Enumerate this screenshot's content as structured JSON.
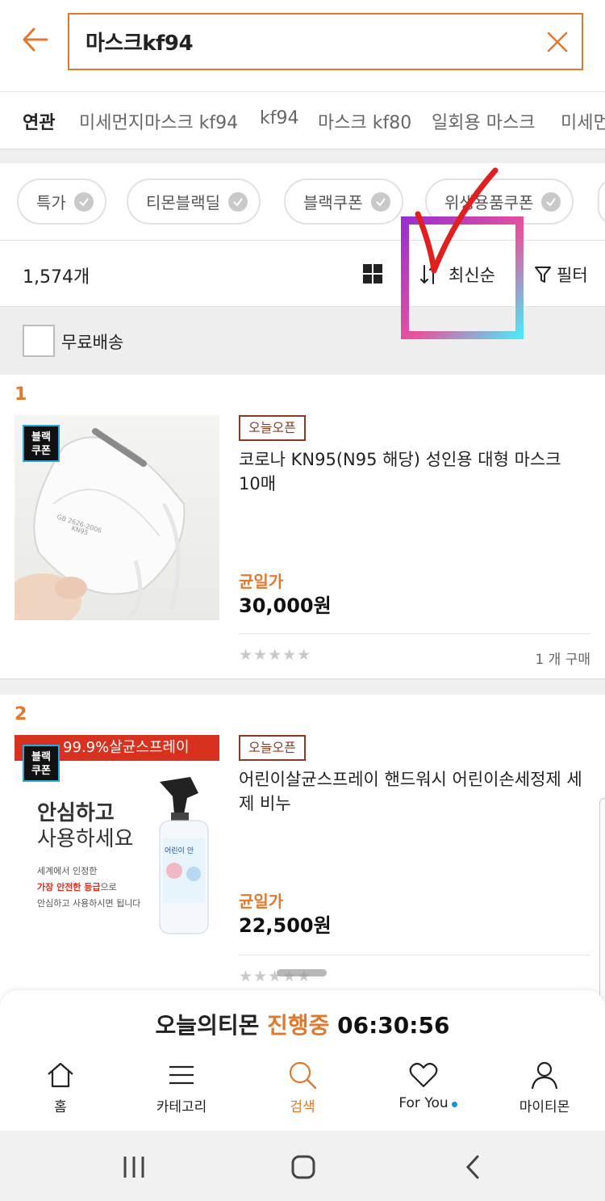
{
  "search": {
    "query": "마스크kf94"
  },
  "related": {
    "title": "연관",
    "items": [
      "미세먼지마스크 kf94",
      "kf94",
      "마스크 kf80",
      "일회용 마스크",
      "미세먼"
    ]
  },
  "chips": [
    "특가",
    "티몬블랙딜",
    "블랙쿠폰",
    "위생용품쿠폰"
  ],
  "toolbar": {
    "count": "1,574개",
    "sort_label": "최신순",
    "filter_label": "필터"
  },
  "free_shipping_label": "무료배송",
  "products": [
    {
      "rank": "1",
      "badge": "블랙\n쿠폰",
      "tag": "오늘오픈",
      "name": "코로나 KN95(N95 해당) 성인용 대형 마스크 10매",
      "price_label": "균일가",
      "price": "30,000원",
      "stars": "★★★★★",
      "buys": "1 개 구매",
      "image_text": [
        "GB 2626-2006",
        "KN95"
      ]
    },
    {
      "rank": "2",
      "badge": "블랙\n쿠폰",
      "tag": "오늘오픈",
      "name": "어린이살균스프레이 핸드워시 어린이손세정제 세제 비누",
      "price_label": "균일가",
      "price": "22,500원",
      "stars": "★★★★★",
      "image_text": {
        "banner": "99.9%살균스프레이",
        "headline1": "안심하고",
        "headline2": "사용하세요",
        "line1": "세계에서 인정한",
        "line2a": "가장 안전한 등급",
        "line2b": "으로",
        "line3": "안심하고 사용하시면 됩니다",
        "bottle": "어린이 안"
      }
    }
  ],
  "timer": {
    "prefix": "오늘의티몬",
    "status": "진행중",
    "time": "06:30:56"
  },
  "nav": [
    {
      "label": "홈",
      "icon": "home-icon"
    },
    {
      "label": "카테고리",
      "icon": "menu-icon"
    },
    {
      "label": "검색",
      "icon": "search-icon"
    },
    {
      "label": "For You",
      "icon": "heart-icon"
    },
    {
      "label": "마이티몬",
      "icon": "person-icon"
    }
  ],
  "colors": {
    "accent": "#e0782d",
    "tag": "#8a3a22",
    "annotation_check": "#e02020"
  }
}
